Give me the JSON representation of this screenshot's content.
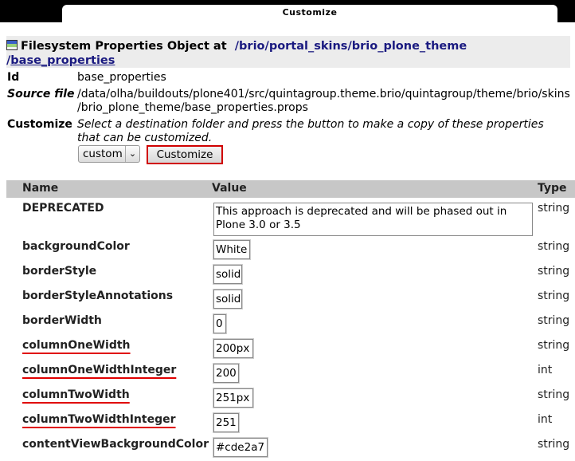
{
  "window": {
    "tab_title": "Customize"
  },
  "heading": {
    "prefix": "Filesystem Properties Object at",
    "path": [
      "brio",
      "portal_skins",
      "brio_plone_theme",
      "base_properties"
    ],
    "separator": "/"
  },
  "info": {
    "id_label": "Id",
    "id_value": "base_properties",
    "source_label": "Source file",
    "source_line1": "/data/olha/buildouts/plone401/src/quintagroup.theme.brio/quintagroup/theme/brio/skins",
    "source_line2": "/brio_plone_theme/base_properties.props",
    "customize_label": "Customize",
    "customize_desc": "Select a destination folder and press the button to make a copy of these properties that can be customized.",
    "folder_select": "custom",
    "customize_button": "Customize"
  },
  "table": {
    "headers": {
      "name": "Name",
      "value": "Value",
      "type": "Type"
    },
    "rows": [
      {
        "name": "DEPRECATED",
        "value": "This approach is deprecated and will be phased out in Plone 3.0 or 3.5",
        "type": "string"
      },
      {
        "name": "backgroundColor",
        "value": "White",
        "type": "string"
      },
      {
        "name": "borderStyle",
        "value": "solid",
        "type": "string"
      },
      {
        "name": "borderStyleAnnotations",
        "value": "solid",
        "type": "string"
      },
      {
        "name": "borderWidth",
        "value": "0",
        "type": "string"
      },
      {
        "name": "columnOneWidth",
        "value": "200px",
        "type": "string"
      },
      {
        "name": "columnOneWidthInteger",
        "value": "200",
        "type": "int"
      },
      {
        "name": "columnTwoWidth",
        "value": "251px",
        "type": "string"
      },
      {
        "name": "columnTwoWidthInteger",
        "value": "251",
        "type": "int"
      },
      {
        "name": "contentViewBackgroundColor",
        "value": "#cde2a7",
        "type": "string"
      }
    ]
  },
  "colors": {
    "link": "#1a1a80",
    "highlight": "#e00000",
    "header_bg": "#c7c7c7"
  }
}
